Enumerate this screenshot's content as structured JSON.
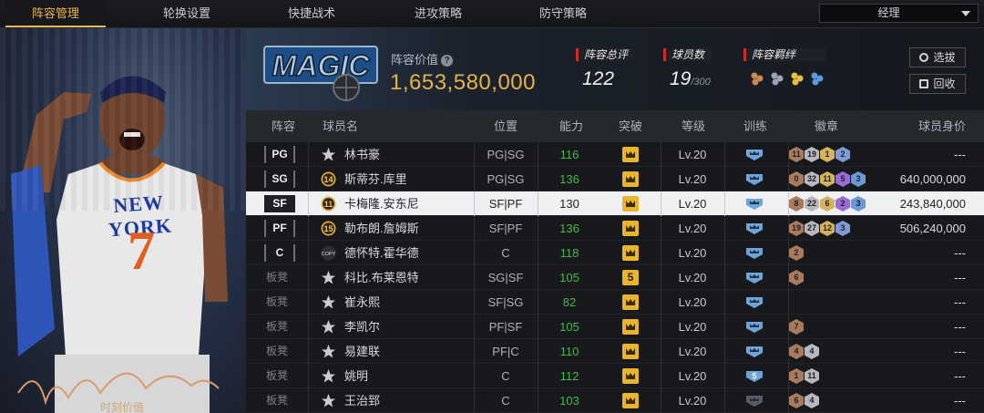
{
  "tabs": [
    {
      "label": "阵容管理",
      "active": true
    },
    {
      "label": "轮换设置",
      "active": false
    },
    {
      "label": "快捷战术",
      "active": false
    },
    {
      "label": "进攻策略",
      "active": false
    },
    {
      "label": "防守策略",
      "active": false
    }
  ],
  "role_select": {
    "value": "经理"
  },
  "player_card": {
    "caption": "时刻价值",
    "jersey_team": "NEW YORK",
    "jersey_number": "7"
  },
  "team": {
    "logo_text": "MAGIC",
    "lineup_value_label": "阵容价值",
    "lineup_value": "1,653,580,000",
    "rating_label": "阵容总评",
    "rating": "122",
    "player_count_label": "球员数",
    "player_count": "19",
    "player_count_max": "/300",
    "bond_label": "阵容羁绊",
    "buttons": {
      "select": "选拔",
      "recycle": "回收"
    }
  },
  "table": {
    "headers": [
      "阵容",
      "球员名",
      "位置",
      "能力",
      "突破",
      "等级",
      "训练",
      "徽章",
      "球员身价"
    ],
    "rows": [
      {
        "slot": "PG",
        "starter": true,
        "num": "",
        "name": "林书豪",
        "pos": "PG|SG",
        "ability": "116",
        "breakthrough": "",
        "level": "Lv.20",
        "train": "blue",
        "medals": [
          [
            "11",
            "#a97a5e"
          ],
          [
            "19",
            "#b8b8c0"
          ],
          [
            "1",
            "#d3b35c"
          ],
          [
            "2",
            "#7f9ad6"
          ]
        ],
        "value": "---"
      },
      {
        "slot": "SG",
        "starter": true,
        "num": "14",
        "name": "斯蒂芬.库里",
        "pos": "PG|SG",
        "ability": "136",
        "breakthrough": "",
        "level": "Lv.20",
        "train": "blue",
        "medals": [
          [
            "0",
            "#a97a5e"
          ],
          [
            "32",
            "#b8b8c0"
          ],
          [
            "11",
            "#d3b35c"
          ],
          [
            "5",
            "#9a6ad6"
          ],
          [
            "3",
            "#6a9ad6"
          ]
        ],
        "value": "640,000,000"
      },
      {
        "slot": "SF",
        "starter": true,
        "num": "11",
        "name": "卡梅隆.安东尼",
        "pos": "SF|PF",
        "ability": "130",
        "breakthrough": "",
        "level": "Lv.20",
        "train": "blue",
        "medals": [
          [
            "8",
            "#a97a5e"
          ],
          [
            "22",
            "#b8b8c0"
          ],
          [
            "6",
            "#d3b35c"
          ],
          [
            "2",
            "#9a6ad6"
          ],
          [
            "3",
            "#6a9ad6"
          ]
        ],
        "value": "243,840,000",
        "highlight": true
      },
      {
        "slot": "PF",
        "starter": true,
        "num": "15",
        "name": "勒布朗.詹姆斯",
        "pos": "SF|PF",
        "ability": "136",
        "breakthrough": "",
        "level": "Lv.20",
        "train": "blue",
        "medals": [
          [
            "19",
            "#a97a5e"
          ],
          [
            "27",
            "#b8b8c0"
          ],
          [
            "12",
            "#d3b35c"
          ],
          [
            "3",
            "#7f9ad6"
          ]
        ],
        "value": "506,240,000"
      },
      {
        "slot": "C",
        "starter": true,
        "num": "COPY",
        "name": "德怀特.霍华德",
        "pos": "C",
        "ability": "118",
        "breakthrough": "",
        "level": "Lv.20",
        "train": "blue",
        "medals": [
          [
            "2",
            "#a97a5e"
          ]
        ],
        "value": "---"
      },
      {
        "slot": "板凳",
        "starter": false,
        "num": "",
        "name": "科比.布莱恩特",
        "pos": "SG|SF",
        "ability": "105",
        "breakthrough": "5",
        "level": "Lv.20",
        "train": "blue",
        "medals": [
          [
            "6",
            "#a97a5e"
          ]
        ],
        "value": "---"
      },
      {
        "slot": "板凳",
        "starter": false,
        "num": "",
        "name": "崔永熙",
        "pos": "SF|SG",
        "ability": "82",
        "breakthrough": "",
        "level": "Lv.20",
        "train": "blue",
        "medals": [],
        "value": "---"
      },
      {
        "slot": "板凳",
        "starter": false,
        "num": "",
        "name": "李凯尔",
        "pos": "PF|SF",
        "ability": "105",
        "breakthrough": "",
        "level": "Lv.20",
        "train": "blue",
        "medals": [
          [
            "7",
            "#a97a5e"
          ]
        ],
        "value": "---"
      },
      {
        "slot": "板凳",
        "starter": false,
        "num": "",
        "name": "易建联",
        "pos": "PF|C",
        "ability": "110",
        "breakthrough": "",
        "level": "Lv.20",
        "train": "blue",
        "medals": [
          [
            "4",
            "#a97a5e"
          ],
          [
            "4",
            "#b8b8c0"
          ]
        ],
        "value": "---"
      },
      {
        "slot": "板凳",
        "starter": false,
        "num": "",
        "name": "姚明",
        "pos": "C",
        "ability": "112",
        "breakthrough": "",
        "level": "Lv.20",
        "train": "blue5",
        "medals": [
          [
            "1",
            "#a97a5e"
          ],
          [
            "11",
            "#b8b8c0"
          ]
        ],
        "value": "---"
      },
      {
        "slot": "板凳",
        "starter": false,
        "num": "",
        "name": "王治郅",
        "pos": "C",
        "ability": "103",
        "breakthrough": "",
        "level": "Lv.20",
        "train": "gray",
        "medals": [
          [
            "6",
            "#a97a5e"
          ],
          [
            "4",
            "#b8b8c0"
          ]
        ],
        "value": "---"
      }
    ]
  }
}
